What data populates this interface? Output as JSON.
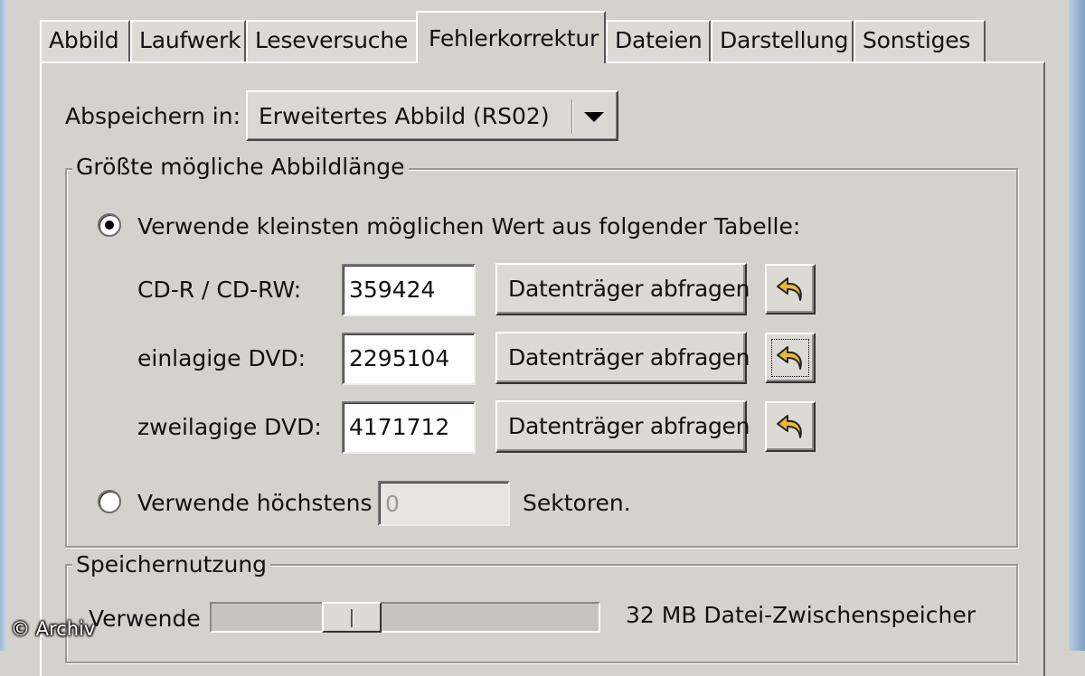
{
  "tabs": [
    {
      "label": "Abbild",
      "active": false
    },
    {
      "label": "Laufwerk",
      "active": false
    },
    {
      "label": "Leseversuche",
      "active": false
    },
    {
      "label": "Fehlerkorrektur",
      "active": true
    },
    {
      "label": "Dateien",
      "active": false
    },
    {
      "label": "Darstellung",
      "active": false
    },
    {
      "label": "Sonstiges",
      "active": false
    }
  ],
  "save": {
    "label": "Abspeichern in:",
    "selected": "Erweitertes Abbild (RS02)"
  },
  "max_image": {
    "title": "Größte mögliche Abbildlänge",
    "option_table": {
      "label": "Verwende kleinsten möglichen Wert aus folgender Tabelle:",
      "checked": true
    },
    "rows": [
      {
        "label": "CD-R / CD-RW:",
        "value": "359424",
        "query_label": "Datenträger abfragen",
        "reset_icon": "undo-arrow-icon"
      },
      {
        "label": "einlagige DVD:",
        "value": "2295104",
        "query_label": "Datenträger abfragen",
        "reset_icon": "undo-arrow-icon"
      },
      {
        "label": "zweilagige DVD:",
        "value": "4171712",
        "query_label": "Datenträger abfragen",
        "reset_icon": "undo-arrow-icon"
      }
    ],
    "option_max": {
      "label": "Verwende höchstens",
      "value": "0",
      "unit": "Sektoren.",
      "checked": false
    }
  },
  "memory": {
    "title": "Speichernutzung",
    "use_label": "Verwende",
    "cache_text": "32 MB Datei-Zwischenspeicher",
    "slider_fraction": 0.34
  },
  "watermark": "© Archiv",
  "colors": {
    "dialog_bg": "#d4d2cc",
    "icon_arrow": "#e8b83a",
    "frame_blue": "#9fb9d6"
  }
}
